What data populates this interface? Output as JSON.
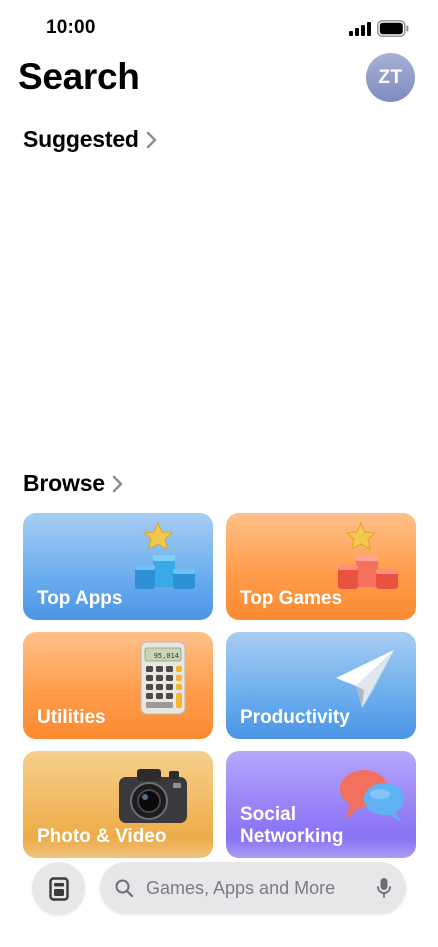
{
  "status_bar": {
    "time": "10:00"
  },
  "header": {
    "title": "Search",
    "avatar_initials": "ZT"
  },
  "sections": {
    "suggested": "Suggested",
    "browse": "Browse"
  },
  "browse": {
    "tiles": [
      {
        "label": "Top Apps",
        "icon": "podium-blue-icon"
      },
      {
        "label": "Top Games",
        "icon": "podium-red-icon"
      },
      {
        "label": "Utilities",
        "icon": "calculator-icon",
        "display": "95,014"
      },
      {
        "label": "Productivity",
        "icon": "paper-plane-icon"
      },
      {
        "label": "Photo & Video",
        "icon": "camera-icon"
      },
      {
        "label": "Social Networking",
        "icon": "chat-bubbles-icon"
      }
    ]
  },
  "search": {
    "placeholder": "Games, Apps and More"
  },
  "colors": {
    "blue": "#6fb0ee",
    "orange": "#ff9d4c",
    "amber": "#f0b559",
    "purple": "#947df6"
  }
}
